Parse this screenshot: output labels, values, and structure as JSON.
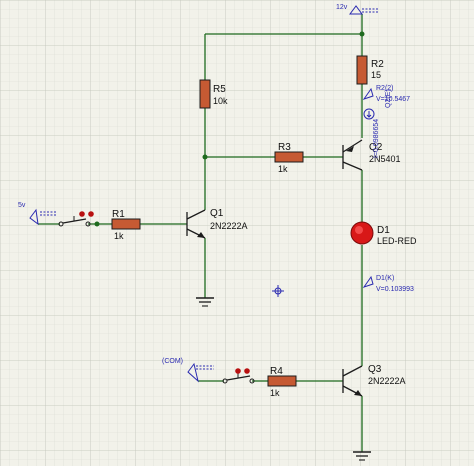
{
  "components": {
    "r1": {
      "ref": "R1",
      "value": "1k"
    },
    "r2": {
      "ref": "R2",
      "value": "15"
    },
    "r3": {
      "ref": "R3",
      "value": "1k"
    },
    "r4": {
      "ref": "R4",
      "value": "1k"
    },
    "r5": {
      "ref": "R5",
      "value": "10k"
    },
    "q1": {
      "ref": "Q1",
      "part": "2N2222A"
    },
    "q2": {
      "ref": "Q2",
      "part": "2N5401"
    },
    "q3": {
      "ref": "Q3",
      "part": "2N2222A"
    },
    "d1": {
      "ref": "D1",
      "part": "LED-RED"
    }
  },
  "ports": {
    "supply": "12v",
    "input": "5v",
    "com": "(COM)"
  },
  "probes": {
    "r2": {
      "name": "R2(2)",
      "reading": "V=10.5467"
    },
    "q2_current": {
      "name": "Q2(E)",
      "reading": "I=0.0986654"
    },
    "d1": {
      "name": "D1(K)",
      "reading": "V=0.103993"
    }
  },
  "colors": {
    "wire": "#1e6a1e",
    "probe": "#2a2ab0",
    "led": "#d81818",
    "resistor": "#c65a33",
    "grid_minor": "#d9dbd2",
    "grid_major": "#c2c5ba"
  }
}
